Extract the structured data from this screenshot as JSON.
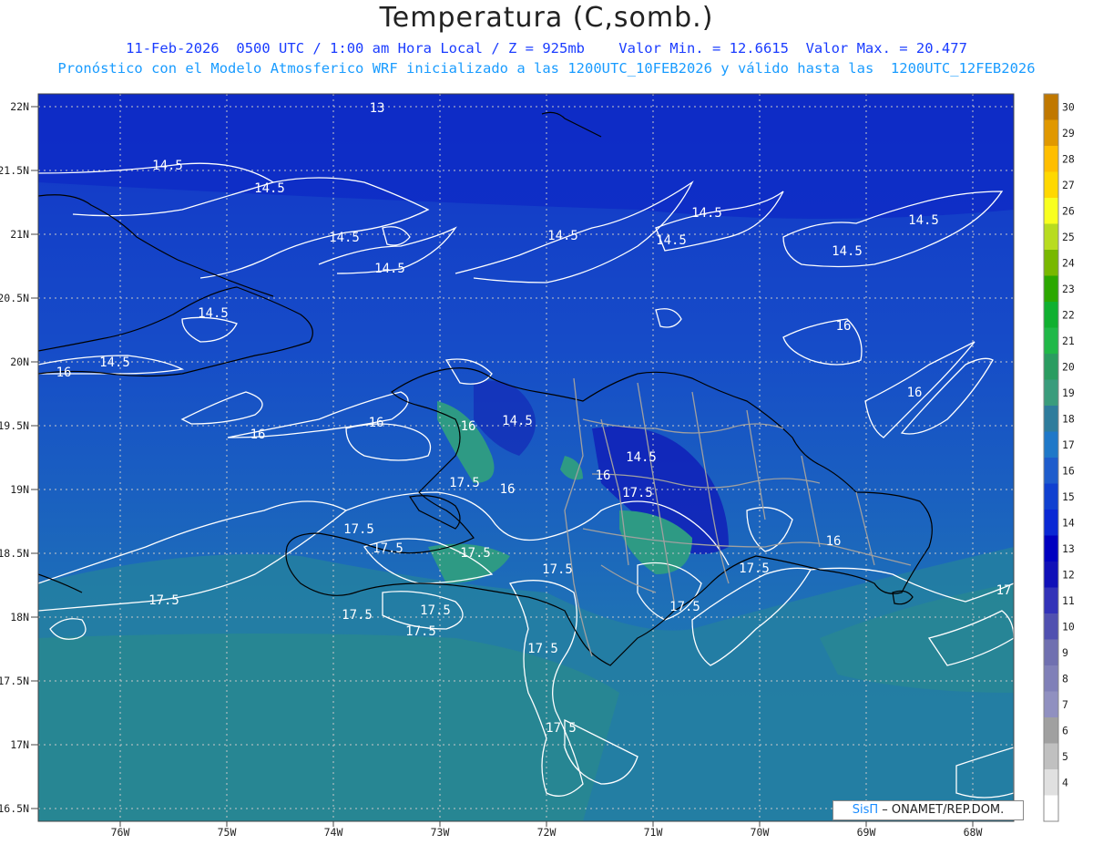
{
  "header": {
    "title": "Temperatura (C,somb.)",
    "line1": "11-Feb-2026  0500 UTC / 1:00 am Hora Local / Z = 925mb    Valor Min. = 12.6615  Valor Max. = 20.477",
    "line2": "Pronóstico con el Modelo Atmosferico WRF inicializado a las 1200UTC_10FEB2026 y válido hasta las  1200UTC_12FEB2026"
  },
  "axes": {
    "lat_labels": [
      "22N",
      "21.5N",
      "21N",
      "20.5N",
      "20N",
      "19.5N",
      "19N",
      "18.5N",
      "18N",
      "17.5N",
      "17N",
      "16.5N"
    ],
    "lon_labels": [
      "76W",
      "75W",
      "74W",
      "73W",
      "72W",
      "71W",
      "70W",
      "69W",
      "68W"
    ]
  },
  "contour_labels": [
    "13",
    "14.5",
    "14.5",
    "14.5",
    "14.5",
    "14.5",
    "14.5",
    "14.5",
    "14.5",
    "14.5",
    "14.5",
    "14.5",
    "14.5",
    "14.5",
    "16",
    "16",
    "16",
    "16",
    "16",
    "16",
    "16",
    "16",
    "16",
    "17.5",
    "17.5",
    "17.5",
    "17.5",
    "17.5",
    "17.5",
    "17.5",
    "17.5",
    "17.5",
    "17.5",
    "17.5",
    "17.5",
    "17.5",
    "17.5",
    "17"
  ],
  "colorbar": {
    "labels": [
      "30",
      "29",
      "28",
      "27",
      "26",
      "25",
      "24",
      "23",
      "22",
      "21",
      "20",
      "19",
      "18",
      "17",
      "16",
      "15",
      "14",
      "13",
      "12",
      "11",
      "10",
      "9",
      "8",
      "7",
      "6",
      "5",
      "4"
    ],
    "colors": [
      "#c07800",
      "#e09800",
      "#ffbe00",
      "#ffd800",
      "#f8ff20",
      "#b8dc20",
      "#78b800",
      "#2ca800",
      "#10b030",
      "#20b848",
      "#2a9c60",
      "#3a9c7c",
      "#2e7c9c",
      "#1f78c8",
      "#1e5ccc",
      "#1040d0",
      "#0a28d4",
      "#0000c0",
      "#1010b8",
      "#3232b8",
      "#5050b0",
      "#7070b0",
      "#8080b8",
      "#9090c0",
      "#a0a0a0",
      "#c0c0c0",
      "#e0e0e0",
      "#ffffff"
    ]
  },
  "credit": {
    "brand": "SisΠ",
    "text": " – ONAMET/REP.DOM."
  }
}
